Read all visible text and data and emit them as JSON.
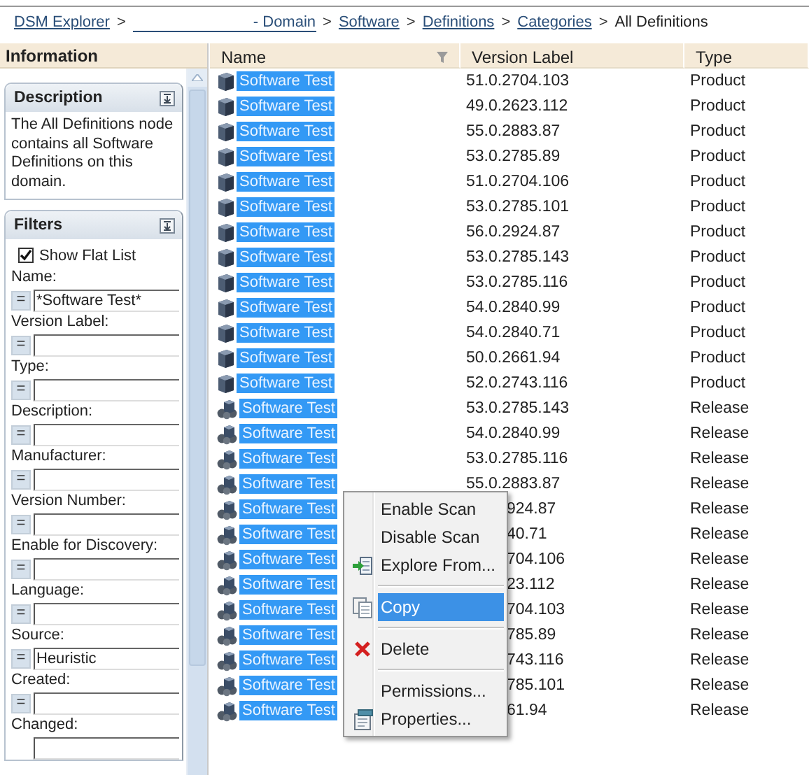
{
  "breadcrumb": [
    {
      "kind": "link",
      "label": "DSM Explorer"
    },
    {
      "kind": "separator",
      "label": ">"
    },
    {
      "kind": "redacted-link",
      "label": "- Domain"
    },
    {
      "kind": "separator",
      "label": ">"
    },
    {
      "kind": "link",
      "label": "Software"
    },
    {
      "kind": "separator",
      "label": ">"
    },
    {
      "kind": "link",
      "label": "Definitions"
    },
    {
      "kind": "separator",
      "label": ">"
    },
    {
      "kind": "link",
      "label": "Categories"
    },
    {
      "kind": "separator",
      "label": ">"
    },
    {
      "kind": "current",
      "label": "All Definitions"
    }
  ],
  "left_panel": {
    "header": "Information",
    "description": {
      "title": "Description",
      "text": "The All Definitions node contains all Software Definitions on this domain."
    },
    "filters": {
      "title": "Filters",
      "show_flat_list": {
        "label": "Show Flat List",
        "checked": true
      },
      "fields": [
        {
          "label": "Name:",
          "operator": "=",
          "value": "*Software Test*"
        },
        {
          "label": "Version Label:",
          "operator": "="
        },
        {
          "label": "Type:",
          "operator": "="
        },
        {
          "label": "Description:",
          "operator": "="
        },
        {
          "label": "Manufacturer:",
          "operator": "="
        },
        {
          "label": "Version Number:",
          "operator": "="
        },
        {
          "label": "Enable for Discovery:",
          "operator": "="
        },
        {
          "label": "Language:",
          "operator": "="
        },
        {
          "label": "Source:",
          "operator": "=",
          "value": "Heuristic"
        },
        {
          "label": "Created:",
          "operator": "="
        },
        {
          "label": "Changed:"
        }
      ]
    }
  },
  "table": {
    "columns": [
      "Name",
      "Version Label",
      "Type"
    ],
    "rows": [
      {
        "kind": "single",
        "name": "Software Test",
        "version": "51.0.2704.103",
        "type": "Product",
        "covered": false,
        "selected": true
      },
      {
        "kind": "single",
        "name": "Software Test",
        "version": "49.0.2623.112",
        "type": "Product",
        "covered": false,
        "selected": true
      },
      {
        "kind": "single",
        "name": "Software Test",
        "version": "55.0.2883.87",
        "type": "Product",
        "covered": false,
        "selected": true
      },
      {
        "kind": "single",
        "name": "Software Test",
        "version": "53.0.2785.89",
        "type": "Product",
        "covered": false,
        "selected": true
      },
      {
        "kind": "single",
        "name": "Software Test",
        "version": "51.0.2704.106",
        "type": "Product",
        "covered": false,
        "selected": true
      },
      {
        "kind": "single",
        "name": "Software Test",
        "version": "53.0.2785.101",
        "type": "Product",
        "covered": false,
        "selected": true
      },
      {
        "kind": "single",
        "name": "Software Test",
        "version": "56.0.2924.87",
        "type": "Product",
        "covered": false,
        "selected": true
      },
      {
        "kind": "single",
        "name": "Software Test",
        "version": "53.0.2785.143",
        "type": "Product",
        "covered": false,
        "selected": true
      },
      {
        "kind": "single",
        "name": "Software Test",
        "version": "53.0.2785.116",
        "type": "Product",
        "covered": false,
        "selected": true
      },
      {
        "kind": "single",
        "name": "Software Test",
        "version": "54.0.2840.99",
        "type": "Product",
        "covered": false,
        "selected": true
      },
      {
        "kind": "single",
        "name": "Software Test",
        "version": "54.0.2840.71",
        "type": "Product",
        "covered": false,
        "selected": true
      },
      {
        "kind": "single",
        "name": "Software Test",
        "version": "50.0.2661.94",
        "type": "Product",
        "covered": false,
        "selected": true
      },
      {
        "kind": "single",
        "name": "Software Test",
        "version": "52.0.2743.116",
        "type": "Product",
        "covered": false,
        "selected": true
      },
      {
        "kind": "group",
        "name": "Software Test",
        "version": "53.0.2785.143",
        "type": "Release",
        "covered": false,
        "selected": true
      },
      {
        "kind": "group",
        "name": "Software Test",
        "version": "54.0.2840.99",
        "type": "Release",
        "covered": false,
        "selected": true
      },
      {
        "kind": "group",
        "name": "Software Test",
        "version": "53.0.2785.116",
        "type": "Release",
        "covered": false,
        "selected": true
      },
      {
        "kind": "group",
        "name": "Software Test",
        "version": "55.0.2883.87",
        "type": "Release",
        "covered": false,
        "selected": true
      },
      {
        "kind": "group",
        "name": "Software Test",
        "version": "924.87",
        "type": "Release",
        "covered": true,
        "selected": true
      },
      {
        "kind": "group",
        "name": "Software Test",
        "version": "40.71",
        "type": "Release",
        "covered": true,
        "selected": true
      },
      {
        "kind": "group",
        "name": "Software Test",
        "version": "704.106",
        "type": "Release",
        "covered": true,
        "selected": true
      },
      {
        "kind": "group",
        "name": "Software Test",
        "version": "23.112",
        "type": "Release",
        "covered": true,
        "selected": true
      },
      {
        "kind": "group",
        "name": "Software Test",
        "version": "704.103",
        "type": "Release",
        "covered": true,
        "selected": true
      },
      {
        "kind": "group",
        "name": "Software Test",
        "version": "785.89",
        "type": "Release",
        "covered": true,
        "selected": true
      },
      {
        "kind": "group",
        "name": "Software Test",
        "version": "743.116",
        "type": "Release",
        "covered": true,
        "selected": true
      },
      {
        "kind": "group",
        "name": "Software Test",
        "version": "785.101",
        "type": "Release",
        "covered": true,
        "selected": true
      },
      {
        "kind": "group",
        "name": "Software Test",
        "version": "61.94",
        "type": "Release",
        "covered": true,
        "selected": true
      }
    ]
  },
  "context_menu": {
    "items": [
      {
        "kind": "item",
        "label": "Enable Scan",
        "selected": false
      },
      {
        "kind": "item",
        "label": "Disable Scan",
        "selected": false
      },
      {
        "kind": "item",
        "label": "Explore From...",
        "selected": false
      },
      {
        "kind": "separator"
      },
      {
        "kind": "item",
        "label": "Copy",
        "selected": true
      },
      {
        "kind": "separator"
      },
      {
        "kind": "item",
        "label": "Delete",
        "selected": false
      },
      {
        "kind": "separator"
      },
      {
        "kind": "item",
        "label": "Permissions...",
        "selected": false
      },
      {
        "kind": "item",
        "label": "Properties...",
        "selected": false
      }
    ]
  }
}
